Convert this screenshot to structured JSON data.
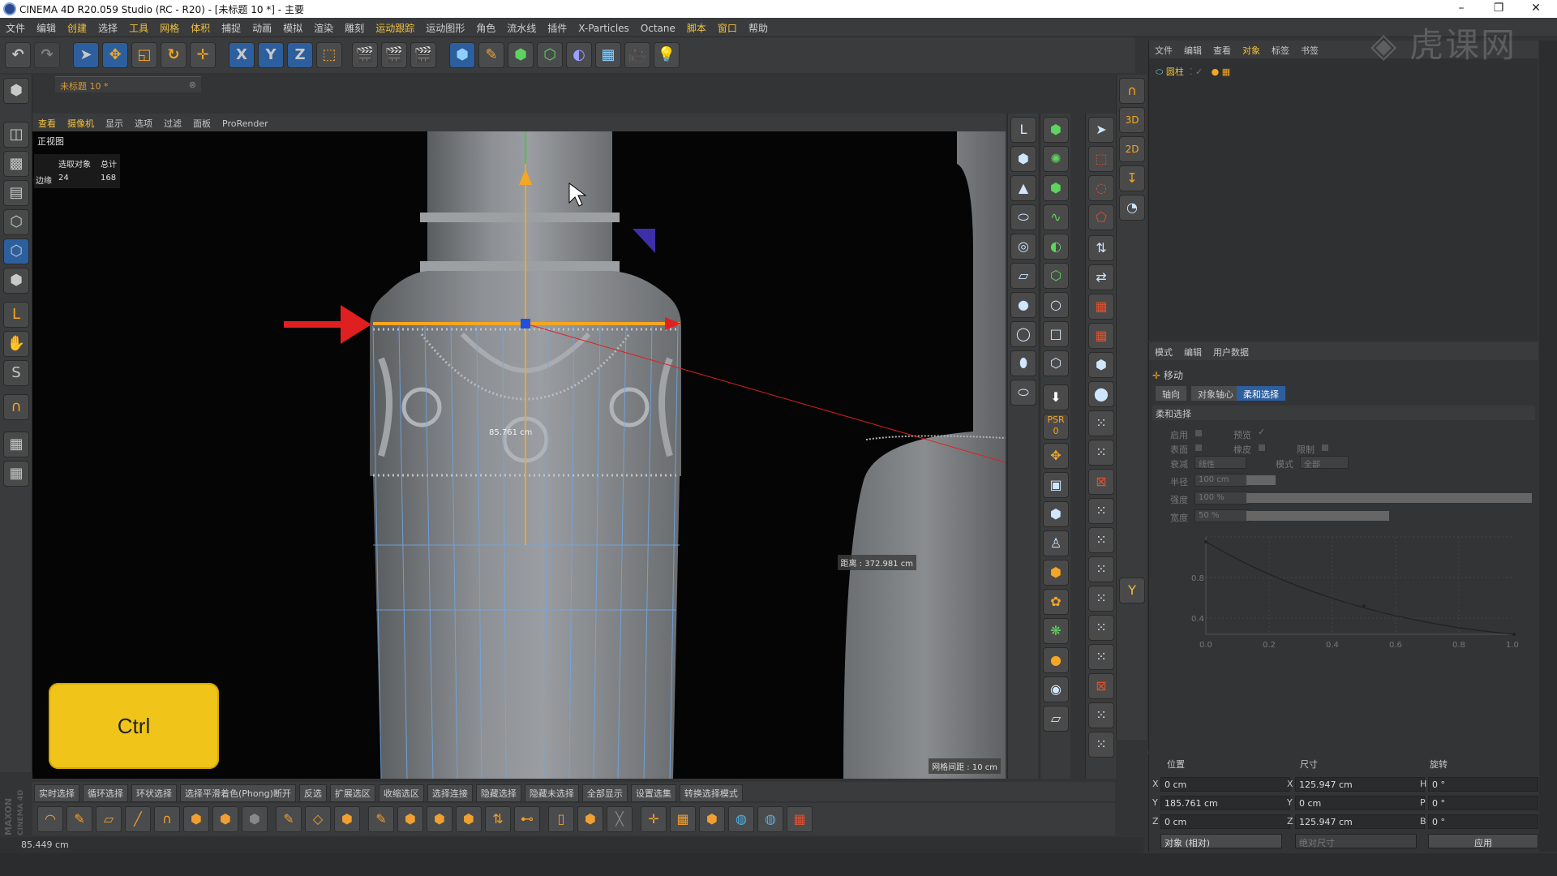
{
  "window": {
    "title": "CINEMA 4D R20.059 Studio (RC - R20) - [未标题 10 *] - 主要"
  },
  "menubar": {
    "items": [
      {
        "label": "文件",
        "hl": false
      },
      {
        "label": "编辑",
        "hl": false
      },
      {
        "label": "创建",
        "hl": true
      },
      {
        "label": "选择",
        "hl": false
      },
      {
        "label": "工具",
        "hl": true
      },
      {
        "label": "网格",
        "hl": true
      },
      {
        "label": "体积",
        "hl": true
      },
      {
        "label": "捕捉",
        "hl": false
      },
      {
        "label": "动画",
        "hl": false
      },
      {
        "label": "模拟",
        "hl": false
      },
      {
        "label": "渲染",
        "hl": false
      },
      {
        "label": "雕刻",
        "hl": false
      },
      {
        "label": "运动跟踪",
        "hl": true
      },
      {
        "label": "运动图形",
        "hl": false
      },
      {
        "label": "角色",
        "hl": false
      },
      {
        "label": "流水线",
        "hl": false
      },
      {
        "label": "插件",
        "hl": false
      },
      {
        "label": "X-Particles",
        "hl": false
      },
      {
        "label": "Octane",
        "hl": false
      },
      {
        "label": "脚本",
        "hl": true
      },
      {
        "label": "窗口",
        "hl": true
      },
      {
        "label": "帮助",
        "hl": false
      }
    ]
  },
  "toolbar": {
    "axis_x": "X",
    "axis_y": "Y",
    "axis_z": "Z"
  },
  "tab": {
    "label": "未标题 10 *"
  },
  "viewport_menu": {
    "items": [
      {
        "label": "查看",
        "hl": true
      },
      {
        "label": "摄像机",
        "hl": true
      },
      {
        "label": "显示",
        "hl": false
      },
      {
        "label": "选项",
        "hl": false
      },
      {
        "label": "过滤",
        "hl": false
      },
      {
        "label": "面板",
        "hl": false
      },
      {
        "label": "ProRender",
        "hl": false
      }
    ]
  },
  "viewport": {
    "view_name": "正视图",
    "hud": {
      "col1": "选取对象",
      "col2": "总计",
      "row_label": "边缘",
      "selected": "24",
      "total": "168"
    },
    "measure": "85.761 cm",
    "distance": "距离 : 372.981 cm",
    "grid_spacing": "网格间距 : 10 cm",
    "key_overlay": "Ctrl"
  },
  "right_tools": {
    "psr_label": "PSR",
    "psr_value": "0",
    "label_3d": "3D",
    "label_2d": "2D"
  },
  "object_manager": {
    "menu": [
      {
        "label": "文件",
        "hl": false
      },
      {
        "label": "编辑",
        "hl": false
      },
      {
        "label": "查看",
        "hl": false
      },
      {
        "label": "对象",
        "hl": true
      },
      {
        "label": "标签",
        "hl": false
      },
      {
        "label": "书签",
        "hl": false
      }
    ],
    "object_name": "圆柱"
  },
  "attribute_manager": {
    "menu": [
      "模式",
      "编辑",
      "用户数据"
    ],
    "tool_name": "移动",
    "tabs": [
      {
        "label": "轴向",
        "on": false
      },
      {
        "label": "对象轴心",
        "on": false
      },
      {
        "label": "柔和选择",
        "on": true
      }
    ],
    "section": "柔和选择",
    "enable_label": "启用",
    "preview_label": "预览",
    "surface_label": "表面",
    "rubber_label": "橡皮",
    "restrict_label": "限制",
    "falloff_label": "衰减",
    "falloff_value": "线性",
    "mode_label": "模式",
    "mode_value": "全部",
    "radius_label": "半径",
    "radius_value": "100 cm",
    "strength_label": "强度",
    "strength_value": "100 %",
    "width_label": "宽度",
    "width_value": "50 %",
    "curve_y_ticks": [
      "0.8",
      "0.4"
    ],
    "curve_x_ticks": [
      "0.0",
      "0.2",
      "0.4",
      "0.6",
      "0.8",
      "1.0"
    ]
  },
  "coordinates": {
    "headers": [
      "位置",
      "尺寸",
      "旋转"
    ],
    "rows": [
      {
        "axis": "X",
        "pos": "0 cm",
        "size_axis": "X",
        "size": "125.947 cm",
        "rot_axis": "H",
        "rot": "0 °"
      },
      {
        "axis": "Y",
        "pos": "185.761 cm",
        "size_axis": "Y",
        "size": "0 cm",
        "rot_axis": "P",
        "rot": "0 °"
      },
      {
        "axis": "Z",
        "pos": "0 cm",
        "size_axis": "Z",
        "size": "125.947 cm",
        "rot_axis": "B",
        "rot": "0 °"
      }
    ],
    "mode_select": "对象 (相对)",
    "size_select": "绝对尺寸",
    "apply_button": "应用"
  },
  "selection_bar": {
    "items": [
      "实时选择",
      "循环选择",
      "环状选择",
      "选择平滑着色(Phong)断开",
      "反选",
      "扩展选区",
      "收缩选区",
      "选择连接",
      "隐藏选择",
      "隐藏未选择",
      "全部显示",
      "设置选集",
      "转换选择模式"
    ]
  },
  "status": {
    "text": "85.449 cm"
  },
  "branding": {
    "maxon": "MAXON CINEMA 4D",
    "watermark": "虎课网"
  },
  "colors": {
    "accent_orange": "#f5a623",
    "selection_blue": "#2d5f9e",
    "menu_highlight": "#f0c040",
    "key_yellow": "#f0c419",
    "arrow_red": "#e02020"
  }
}
